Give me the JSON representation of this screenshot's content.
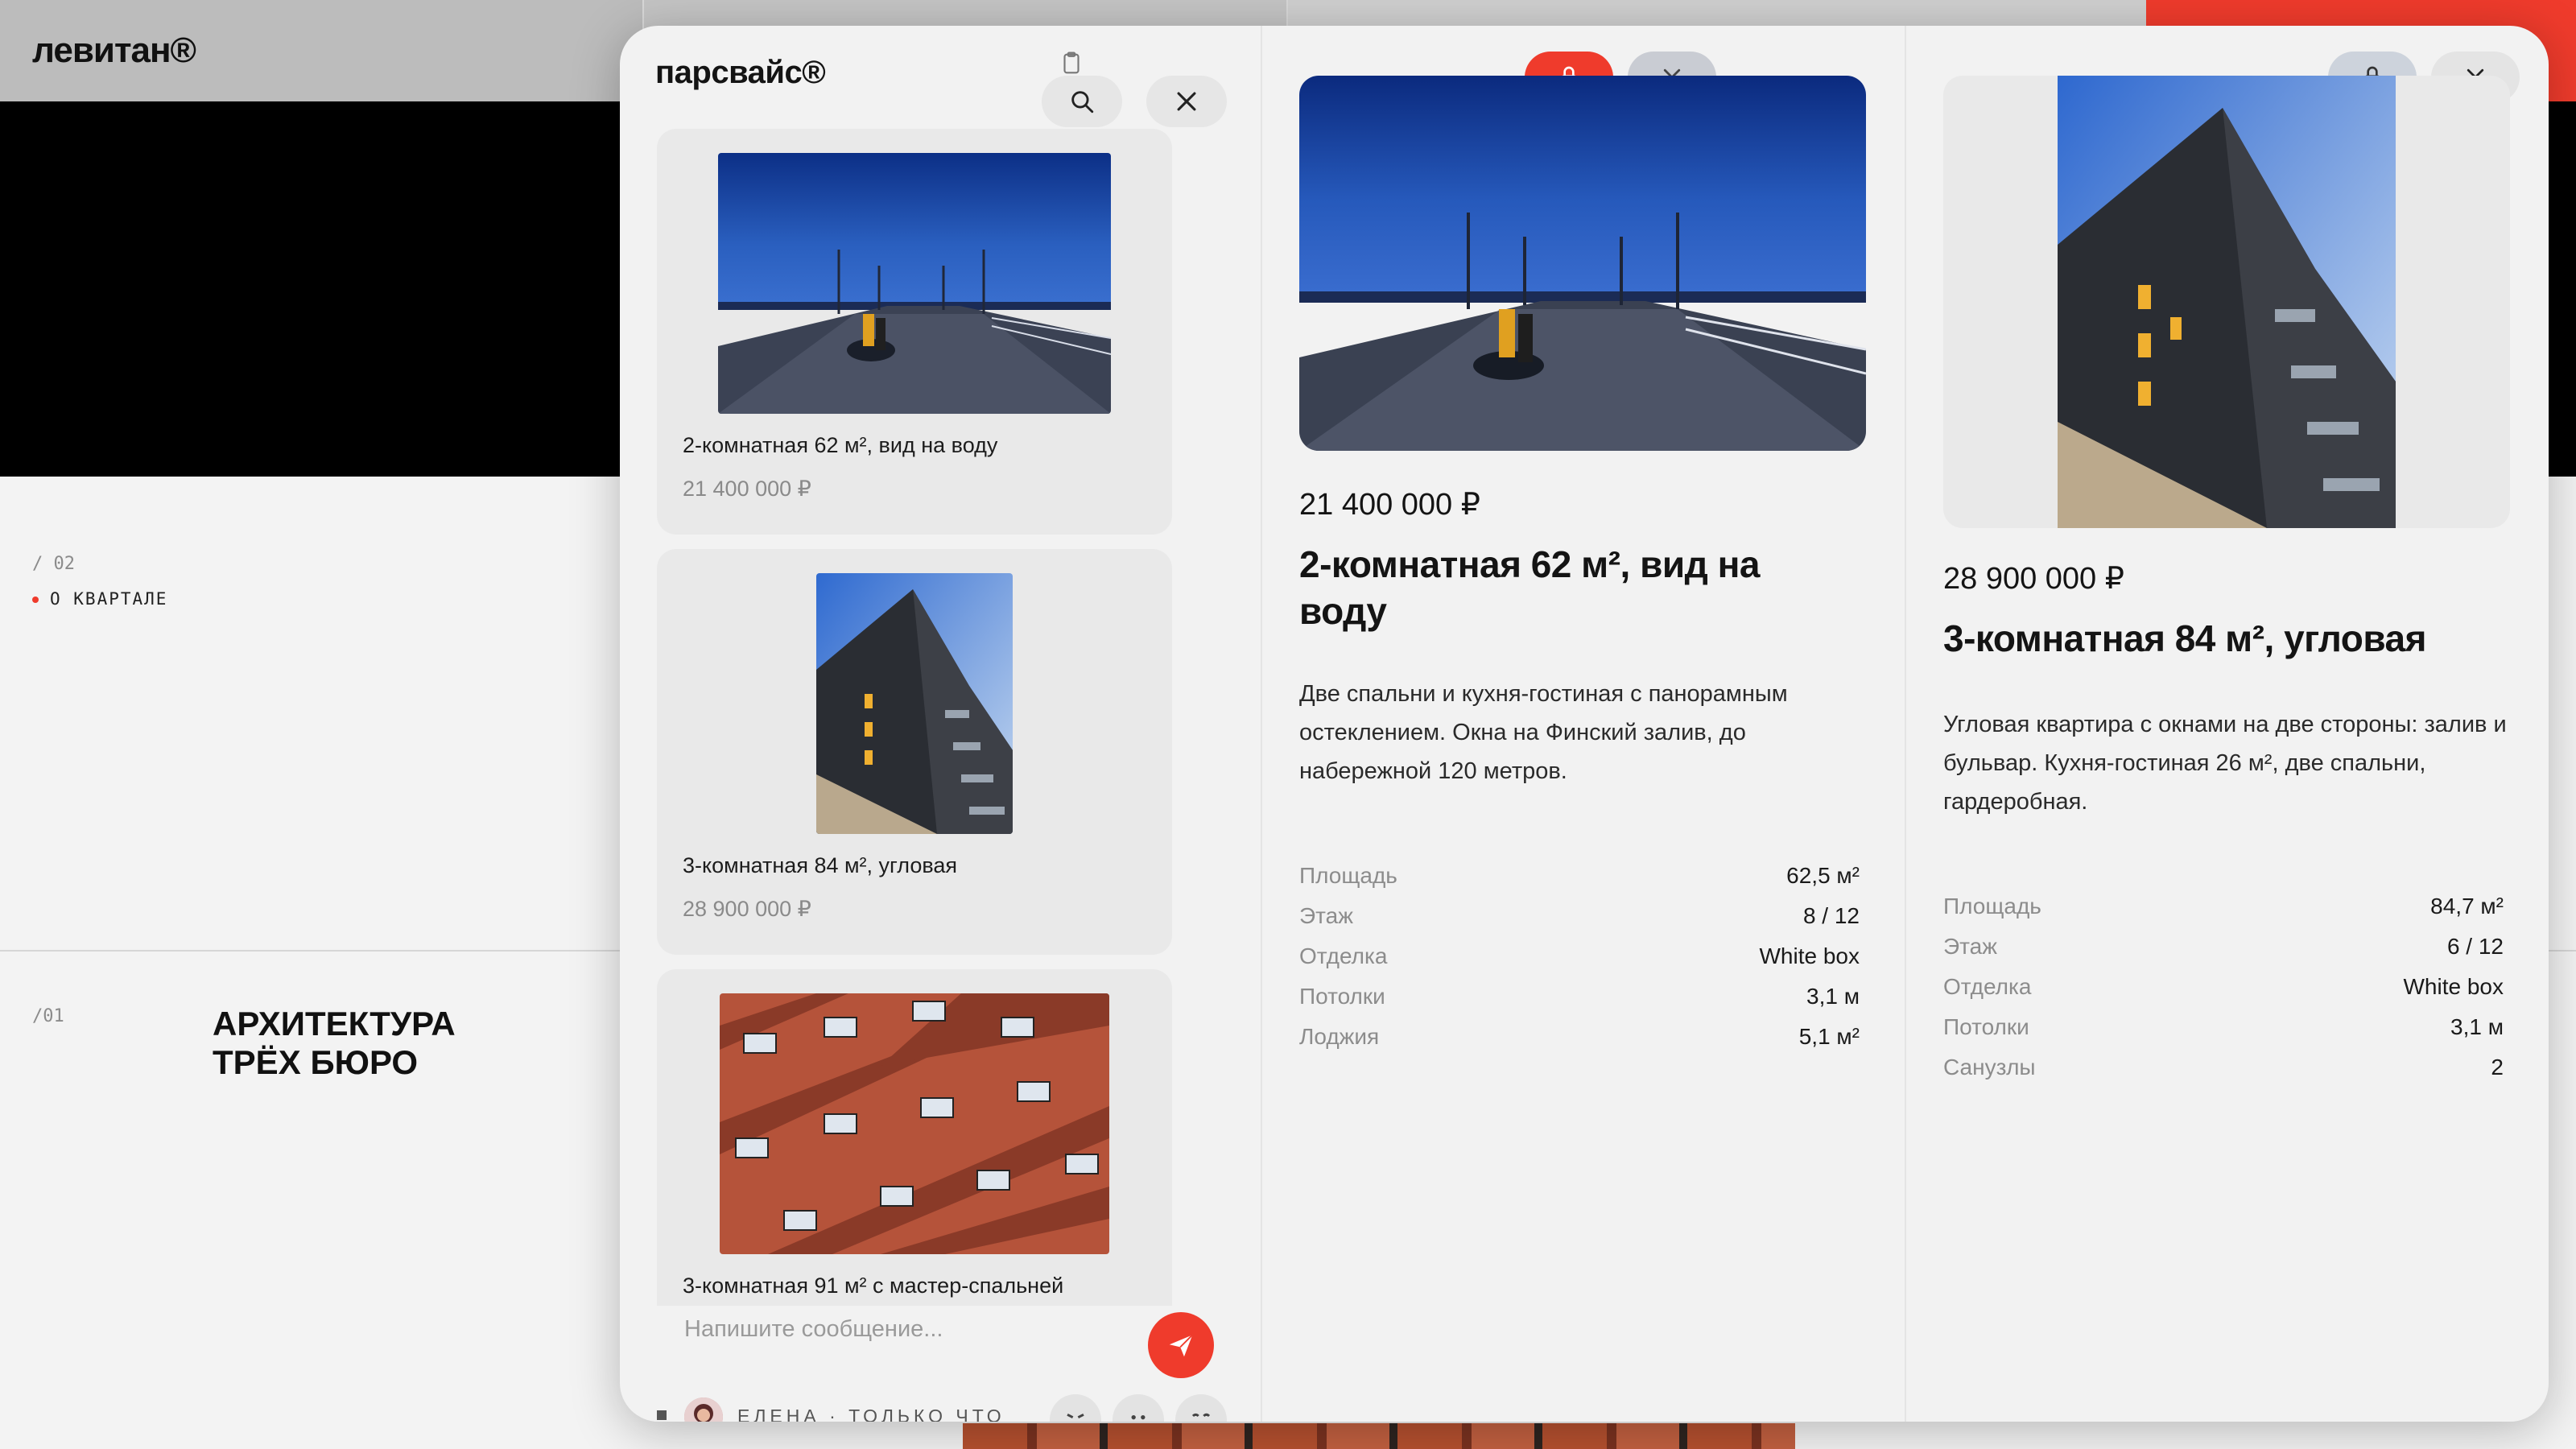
{
  "background": {
    "logo": "левитан®",
    "section_num_02": "/ 02",
    "section_label": "О КВАРТАЛЕ",
    "section_num_01": "/01",
    "heading_line1": "АРХИТЕКТУРА",
    "heading_line2": "ТРЁХ БЮРО"
  },
  "modal": {
    "brand": "парсвайс®",
    "icons": {
      "search": "search-icon",
      "clipboard": "clipboard-icon",
      "close": "close-icon",
      "lock": "lock-icon",
      "send": "send-icon"
    },
    "feed": [
      {
        "title": "2-комнатная 62 м², вид на воду",
        "price": "21 400 000 ₽",
        "image": "pier-photo"
      },
      {
        "title": "3-комнатная 84 м², угловая",
        "price": "28 900 000 ₽",
        "image": "tower-photo"
      },
      {
        "title": "3-комнатная 91 м² с мастер-спальней",
        "price": "",
        "image": "brick-facade-photo"
      }
    ],
    "composer": {
      "placeholder": "Напишите сообщение..."
    },
    "status": {
      "author": "ЕЛЕНА · ТОЛЬКО ЧТО",
      "reactions": [
        "angry-face-icon",
        "neutral-face-icon",
        "smile-face-icon"
      ]
    }
  },
  "details": [
    {
      "price": "21 400 000 ₽",
      "title": "2-комнатная 62 м², вид на воду",
      "description": "Две спальни и кухня-гостиная с панорамным остеклением. Окна на Финский залив, до набережной 120 метров.",
      "specs": [
        {
          "k": "Площадь",
          "v": "62,5 м²"
        },
        {
          "k": "Этаж",
          "v": "8 / 12"
        },
        {
          "k": "Отделка",
          "v": "White box"
        },
        {
          "k": "Потолки",
          "v": "3,1 м"
        },
        {
          "k": "Лоджия",
          "v": "5,1 м²"
        }
      ],
      "locked": true
    },
    {
      "price": "28 900 000 ₽",
      "title": "3-комнатная 84 м², угловая",
      "description": "Угловая квартира с окнами на две стороны: залив и бульвар. Кухня-гостиная 26 м², две спальни, гардеробная.",
      "specs": [
        {
          "k": "Площадь",
          "v": "84,7 м²"
        },
        {
          "k": "Этаж",
          "v": "6 / 12"
        },
        {
          "k": "Отделка",
          "v": "White box"
        },
        {
          "k": "Потолки",
          "v": "3,1 м"
        },
        {
          "k": "Санузлы",
          "v": "2"
        }
      ],
      "locked": false
    }
  ],
  "colors": {
    "accent": "#ef3b2c",
    "panel": "#f2f2f2",
    "card": "#e9e9e9"
  }
}
